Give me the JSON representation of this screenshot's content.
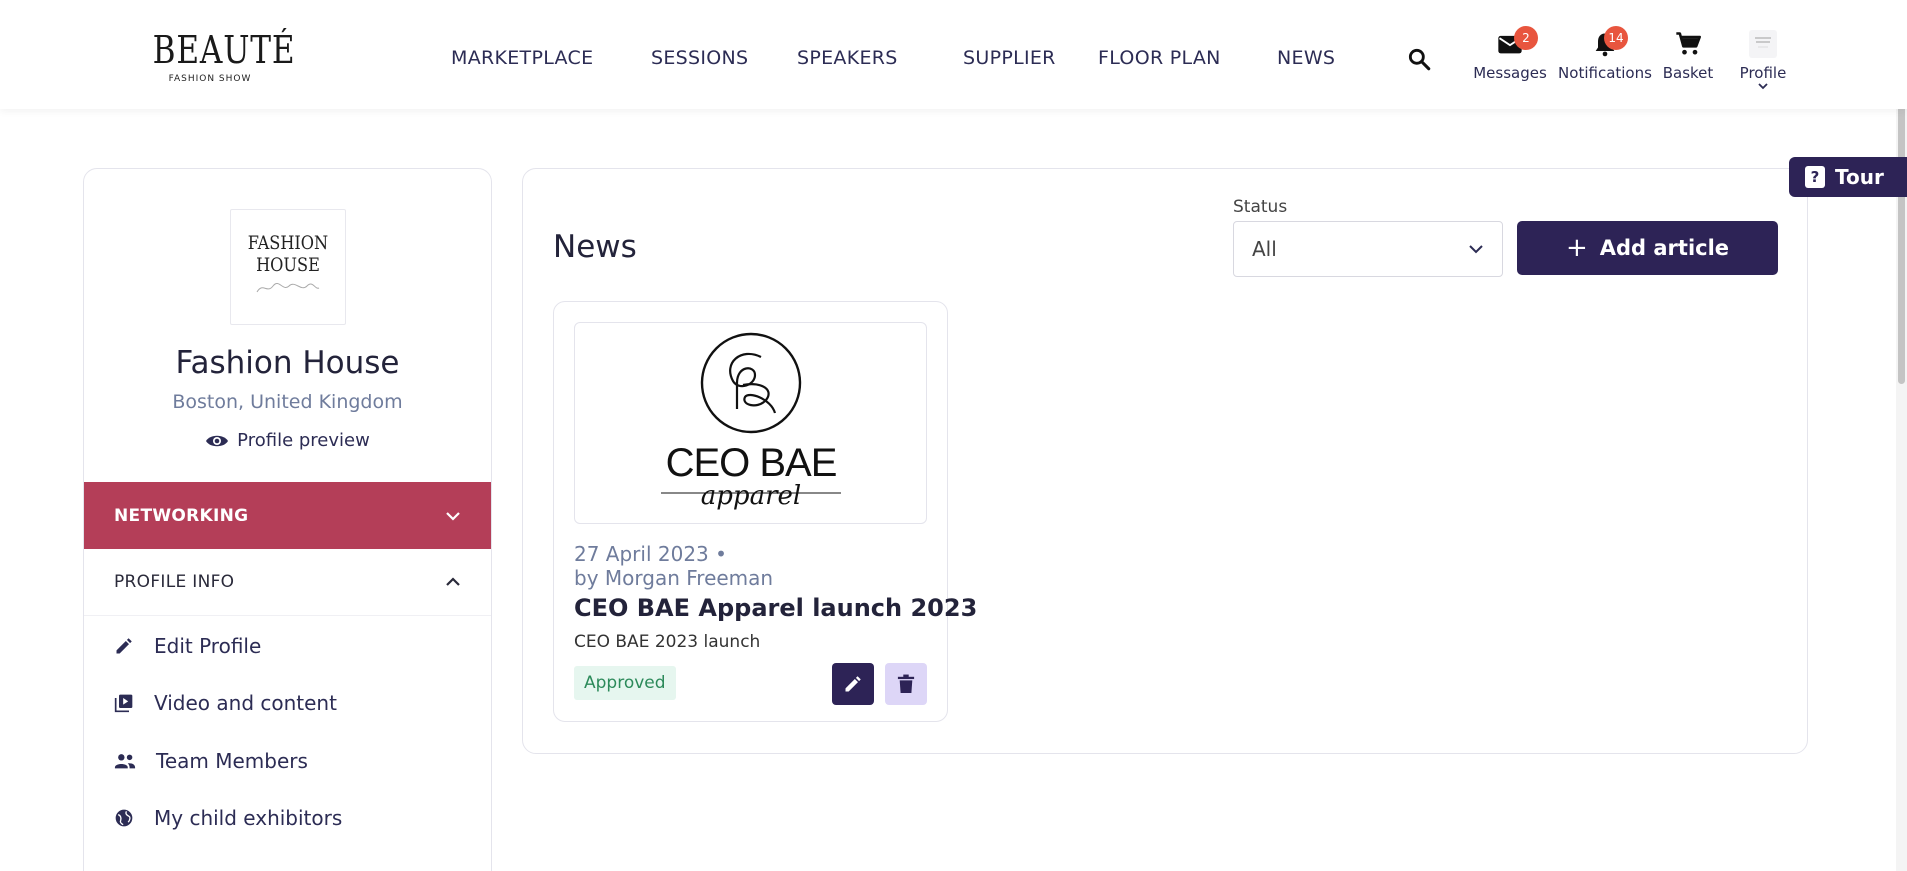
{
  "header": {
    "logo": {
      "title": "BEAUTÉ",
      "subtitle": "FASHION SHOW"
    },
    "nav": [
      {
        "label": "MARKETPLACE"
      },
      {
        "label": "SESSIONS"
      },
      {
        "label": "SPEAKERS"
      },
      {
        "label": "SUPPLIER"
      },
      {
        "label": "FLOOR PLAN"
      },
      {
        "label": "NEWS"
      }
    ],
    "actions": {
      "messages": {
        "label": "Messages",
        "badge": "2"
      },
      "notifications": {
        "label": "Notifications",
        "badge": "14"
      },
      "basket": {
        "label": "Basket"
      },
      "profile": {
        "label": "Profile"
      }
    }
  },
  "tour": {
    "label": "Tour"
  },
  "sidebar": {
    "company_logo": {
      "line1": "FASHION",
      "line2": "HOUSE"
    },
    "company_name": "Fashion House",
    "location": "Boston, United Kingdom",
    "profile_preview": "Profile preview",
    "networking_label": "NETWORKING",
    "profile_info_label": "PROFILE INFO",
    "menu": [
      {
        "label": "Edit Profile",
        "icon": "pencil-icon"
      },
      {
        "label": "Video and content",
        "icon": "video-library-icon"
      },
      {
        "label": "Team Members",
        "icon": "people-icon"
      },
      {
        "label": "My child exhibitors",
        "icon": "globe-icon"
      }
    ]
  },
  "main": {
    "title": "News",
    "status_filter": {
      "label": "Status",
      "value": "All"
    },
    "add_button": "Add article",
    "articles": [
      {
        "image_text": {
          "brand": "CEO BAE",
          "script": "apparel"
        },
        "date": "27 April 2023 •",
        "author": "by Morgan Freeman",
        "title": "CEO BAE Apparel launch 2023",
        "description": "CEO BAE 2023 launch",
        "status": "Approved"
      }
    ]
  },
  "colors": {
    "primary": "#2d2356",
    "networking": "#b43e58",
    "badge": "#e8553e",
    "approved_bg": "#e6f6ef",
    "approved_text": "#2c8a5a",
    "muted": "#6f7c9c"
  }
}
